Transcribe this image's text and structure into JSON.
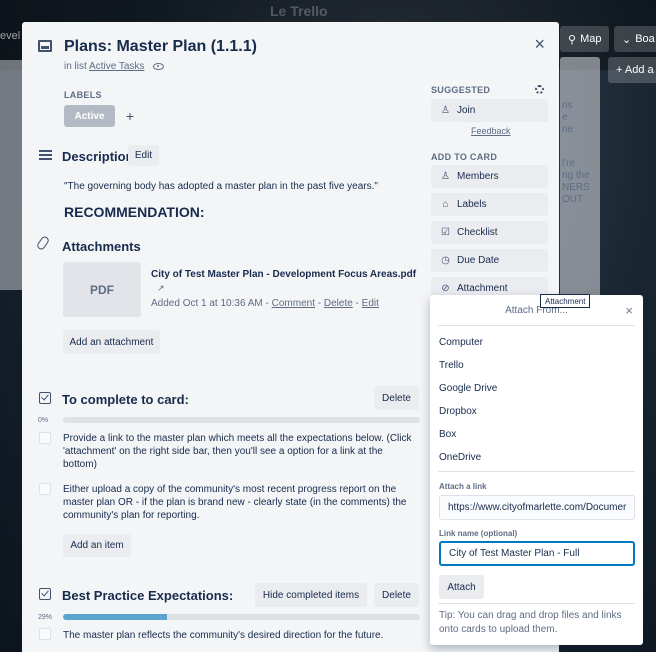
{
  "board": {
    "faint_title": "Le Trello",
    "left_text": "evel",
    "map_label": "Map",
    "boards_label": "Boa",
    "add_list": "+ Add a",
    "list_fragments": [
      "ns",
      "e",
      "ne",
      "l're",
      "ng the",
      "NERS",
      "OUT"
    ]
  },
  "card": {
    "title": "Plans: Master Plan (1.1.1)",
    "in_list_prefix": "in list",
    "in_list_name": "Active Tasks",
    "close": "×",
    "labels_heading": "LABELS",
    "label_chip": "Active",
    "label_add": "+",
    "description": {
      "title": "Description",
      "edit": "Edit",
      "text": "\"The governing body has adopted a master plan in the past five years.\"",
      "heading": "RECOMMENDATION:"
    },
    "attachments": {
      "title": "Attachments",
      "thumb": "PDF",
      "file_name": "City of Test Master Plan - Development Focus Areas.pdf",
      "arrow": "↗",
      "added": "Added Oct 1 at 10:36 AM - ",
      "comment": "Comment",
      "sep1": " - ",
      "delete": "Delete",
      "sep2": " - ",
      "edit": "Edit",
      "add_button": "Add an attachment"
    },
    "checklist1": {
      "title": "To complete to card:",
      "delete": "Delete",
      "percent": "0%",
      "progress": 0,
      "items": [
        "Provide a link to the master plan which meets all the expectations below. (Click 'attachment' on the right side bar, then you'll see a option for a link at the bottom)",
        "Either upload a copy of the community's most recent progress report on the master plan OR - if the plan is brand new - clearly state (in the comments) the community's plan for reporting."
      ],
      "add_item": "Add an item"
    },
    "checklist2": {
      "title": "Best Practice Expectations:",
      "hide": "Hide completed items",
      "delete": "Delete",
      "percent": "29%",
      "progress": 29,
      "items": [
        "The master plan reflects the community's desired direction for the future."
      ]
    }
  },
  "sidebar": {
    "suggested_heading": "SUGGESTED",
    "join": "Join",
    "feedback": "Feedback",
    "add_heading": "ADD TO CARD",
    "members": "Members",
    "labels": "Labels",
    "checklist": "Checklist",
    "due_date": "Due Date",
    "attachment": "Attachment"
  },
  "tooltip": "Attachment",
  "attach_popover": {
    "title": "Attach From...",
    "close": "×",
    "sources": [
      "Computer",
      "Trello",
      "Google Drive",
      "Dropbox",
      "Box",
      "OneDrive"
    ],
    "link_label": "Attach a link",
    "link_value": "https://www.cityofmarlette.com/Documer",
    "name_label": "Link name (optional)",
    "name_value": "City of Test Master Plan - Full",
    "attach_button": "Attach",
    "tip": "Tip: You can drag and drop files and links onto cards to upload them."
  }
}
